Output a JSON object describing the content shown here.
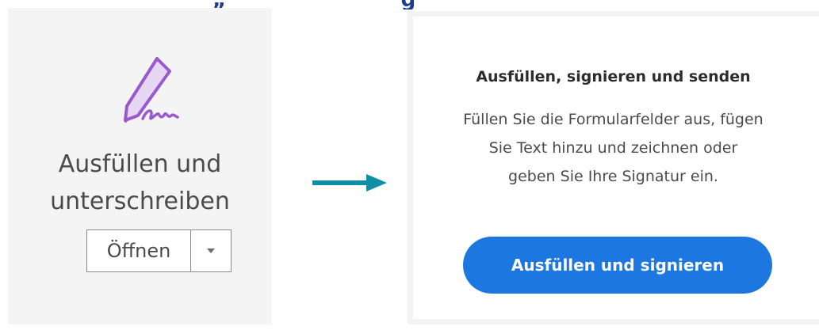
{
  "heading": {
    "visible_fragment": "„ g"
  },
  "left_tool": {
    "icon": "pen-signature-icon",
    "icon_color": "#9b59d0",
    "label_line1": "Ausfüllen und",
    "label_line2": "unterschreiben",
    "open_button_label": "Öffnen",
    "dropdown_icon": "caret-down-icon"
  },
  "arrow": {
    "icon": "arrow-right-icon",
    "color": "#0f8ea6"
  },
  "right_card": {
    "title": "Ausfüllen, signieren und senden",
    "description": "Füllen Sie die Formularfelder aus, fügen Sie Text hinzu und zeichnen oder geben Sie Ihre Signatur ein.",
    "description_lines": [
      "Füllen Sie die Formularfelder aus, fügen",
      "Sie Text hinzu und zeichnen oder",
      "geben Sie Ihre Signatur ein."
    ],
    "button_label": "Ausfüllen und signieren",
    "button_color": "#1c78e0"
  }
}
